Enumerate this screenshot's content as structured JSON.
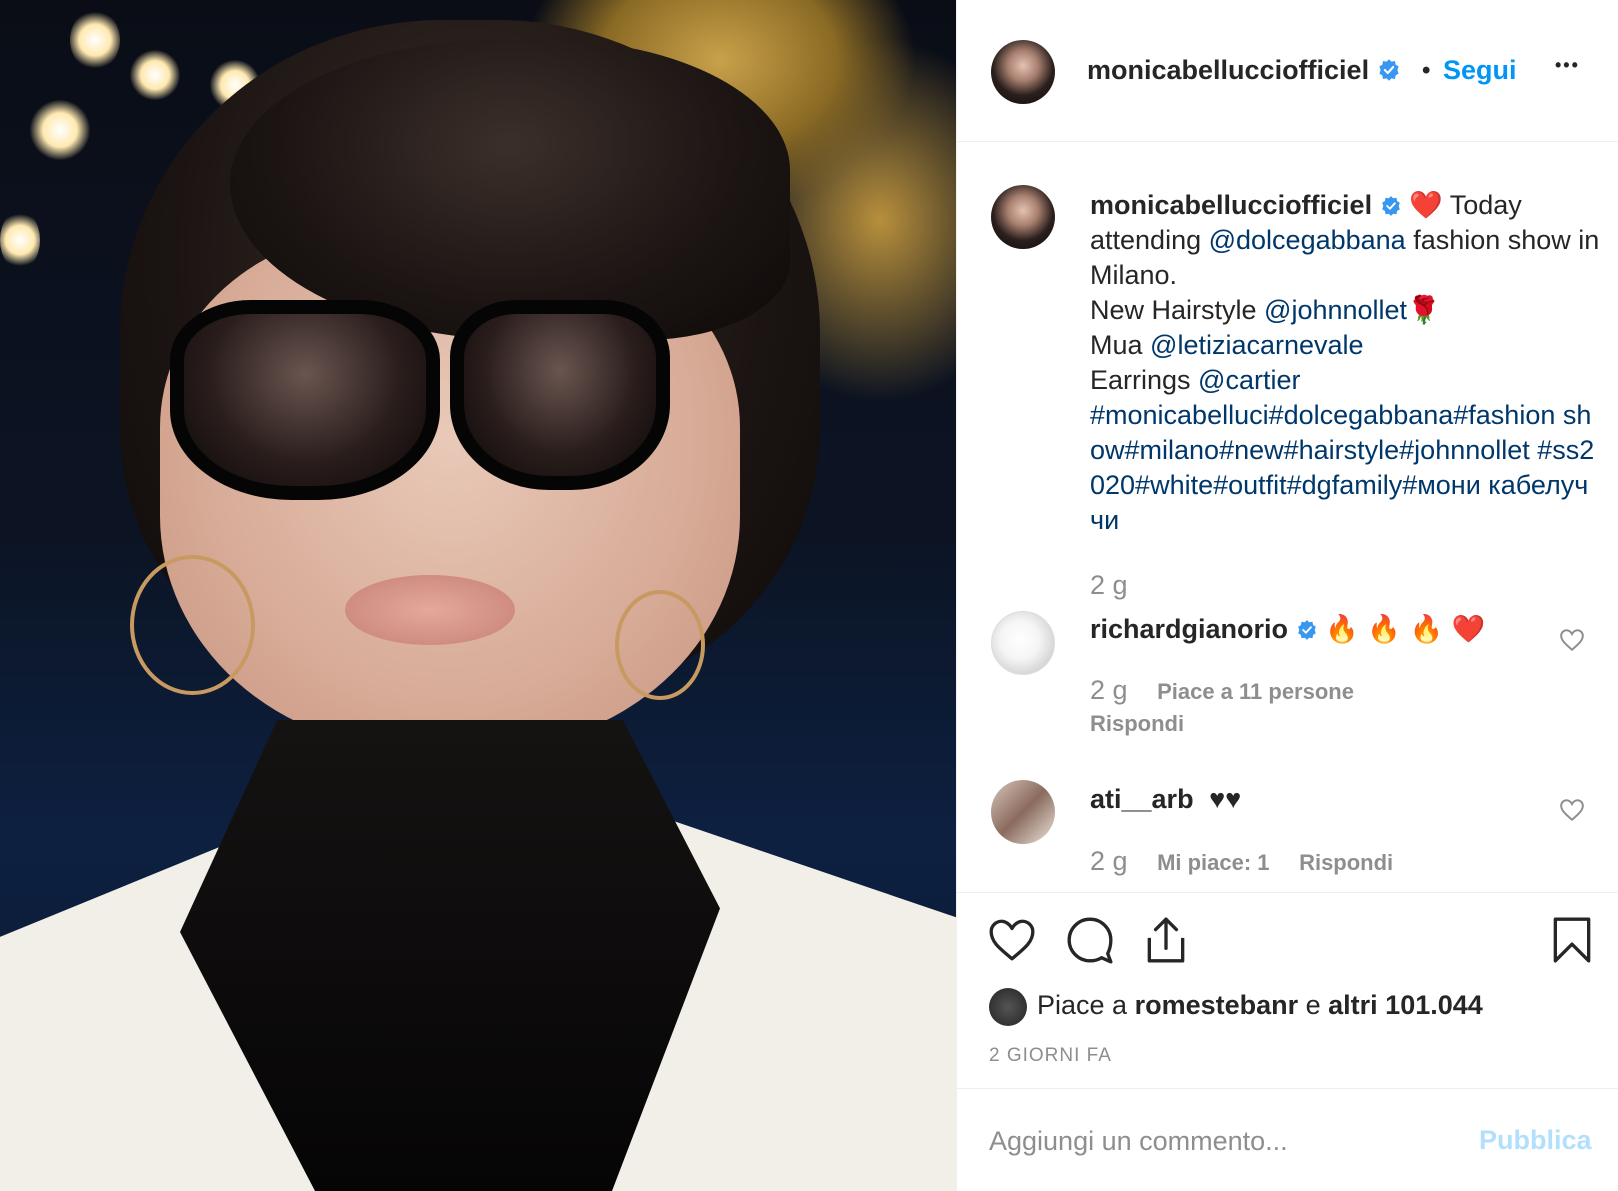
{
  "post": {
    "author": "monicabellucciofficiel",
    "follow_label": "Segui",
    "separator": "•",
    "more_label": "•••"
  },
  "caption": {
    "username": "monicabellucciofficiel",
    "heart": "❤️",
    "text_1": " Today attending ",
    "mention_1": "@dolcegabbana",
    "text_2": " fashion show in Milano.",
    "text_3": "New Hairstyle ",
    "mention_2": "@johnnollet",
    "rose": "🌹",
    "text_4": "Mua ",
    "mention_3": "@letiziacarnevale",
    "text_5": "Earrings ",
    "mention_4": "@cartier",
    "hashtags": "#monicabelluci#dolcegabbana#fashion show#milano#new#hairstyle#johnnollet #ss2020#white#outfit#dgfamily#мони кабелуччи",
    "time": "2 g"
  },
  "comments": [
    {
      "username": "richardgianorio",
      "text": "🔥 🔥 🔥 ❤️",
      "time": "2 g",
      "likes": "Piace a 11 persone",
      "reply": "Rispondi"
    },
    {
      "username": "ati__arb",
      "text": "♥♥",
      "time": "2 g",
      "likes": "Mi piace: 1",
      "reply": "Rispondi"
    }
  ],
  "likes": {
    "prefix": "Piace a ",
    "user": "romestebanr",
    "middle": " e ",
    "count": "altri 101.044"
  },
  "date": "2 GIORNI FA",
  "add_comment": {
    "placeholder": "Aggiungi un commento...",
    "publish_label": "Pubblica"
  },
  "colors": {
    "accent": "#0095f6",
    "link": "#00376b",
    "muted": "#8e8e8e",
    "publish_disabled": "#b2dffc"
  },
  "icons": [
    "verified-badge-icon",
    "more-options-icon",
    "heart-icon",
    "comment-icon",
    "share-icon",
    "bookmark-icon"
  ]
}
